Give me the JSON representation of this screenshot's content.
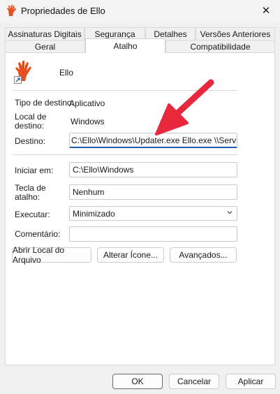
{
  "window": {
    "title": "Propriedades de Ello",
    "close_glyph": "✕"
  },
  "tabs": {
    "row1": [
      "Assinaturas Digitais",
      "Segurança",
      "Detalhes",
      "Versões Anteriores"
    ],
    "row2": [
      "Geral",
      "Atalho",
      "Compatibilidade"
    ],
    "active": "Atalho"
  },
  "shortcut": {
    "name": "Ello",
    "icon": "hand-shortcut-icon",
    "target_type_label": "Tipo de destino:",
    "target_type_value": "Aplicativo",
    "target_location_label": "Local de destino:",
    "target_location_value": "Windows",
    "target_label": "Destino:",
    "target_value": "C:\\Ello\\Windows\\Updater.exe Ello.exe \\\\Servidor",
    "start_in_label": "Iniciar em:",
    "start_in_value": "C:\\Ello\\Windows",
    "hotkey_label": "Tecla de atalho:",
    "hotkey_value": "Nenhum",
    "run_label": "Executar:",
    "run_value": "Minimizado",
    "comment_label": "Comentário:",
    "comment_value": ""
  },
  "actions": {
    "open_location": "Abrir Local do Arquivo",
    "change_icon": "Alterar Ícone...",
    "advanced": "Avançados..."
  },
  "footer": {
    "ok": "OK",
    "cancel": "Cancelar",
    "apply": "Aplicar"
  },
  "colors": {
    "accent": "#1f5fb4",
    "arrow": "#e8283c",
    "icon_orange": "#e8501e"
  }
}
